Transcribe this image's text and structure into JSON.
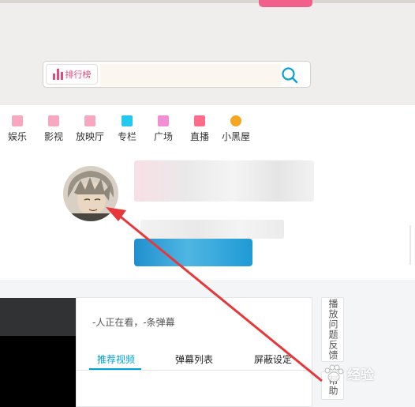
{
  "search": {
    "rank_label": "排行榜",
    "value": ""
  },
  "nav": {
    "items": [
      {
        "label": "娱乐",
        "icon": "entertainment-icon",
        "color": "#f7a7c0"
      },
      {
        "label": "影视",
        "icon": "film-icon",
        "color": "#f7a7c0"
      },
      {
        "label": "放映厅",
        "icon": "theater-icon",
        "color": "#f7a7c0"
      },
      {
        "label": "专栏",
        "icon": "column-icon",
        "color": "#23c9ed"
      },
      {
        "label": "广场",
        "icon": "square-icon",
        "color": "#f28fd3"
      },
      {
        "label": "直播",
        "icon": "live-icon",
        "color": "#ff6b8a"
      },
      {
        "label": "小黑屋",
        "icon": "blackroom-icon",
        "color": "#f5a623"
      }
    ]
  },
  "player": {
    "watch_info": "-人正在看，-条弹幕",
    "tabs": [
      "推荐视频",
      "弹幕列表",
      "屏蔽设定"
    ]
  },
  "side": {
    "feedback": "播放问题反馈",
    "help": "帮助"
  },
  "watermark": {
    "text": "经验"
  },
  "colors": {
    "accent_pink": "#f35f8c",
    "accent_blue": "#00a1d6",
    "arrow_red": "#e8373a"
  }
}
